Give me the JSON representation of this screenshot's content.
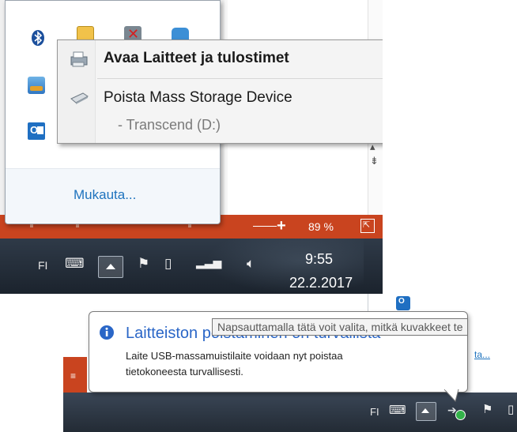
{
  "tray_overflow": {
    "customize_link": "Mukauta...",
    "icons": [
      "bluetooth-icon",
      "usb-drive-icon",
      "red-x-icon",
      "app-icon",
      "network-app-icon",
      "outlook-icon"
    ]
  },
  "context_menu": {
    "items": [
      {
        "label": "Avaa Laitteet ja tulostimet",
        "bold": true,
        "icon": "printer-icon"
      },
      {
        "label": "Poista Mass Storage Device",
        "bold": false,
        "icon": "usb-drive-icon"
      },
      {
        "label": "-  Transcend (D:)",
        "bold": false,
        "icon": ""
      }
    ]
  },
  "word_statusbar": {
    "zoom_plus": "+",
    "zoom_level": "89 %"
  },
  "taskbar_top": {
    "language": "FI",
    "time": "9:55",
    "date": "22.2.2017"
  },
  "balloon": {
    "title": "Laitteiston poistaminen on turvallista",
    "message_line1": "Laite USB-massamuistilaite voidaan nyt poistaa",
    "message_line2": "tietokoneesta turvallisesti."
  },
  "tooltip": {
    "text": "Napsauttamalla tätä voit valita, mitkä kuvakkeet te"
  },
  "behind_link": {
    "text": "ta..."
  },
  "taskbar_bottom": {
    "language": "FI"
  },
  "colors": {
    "office_accent": "#c9441f",
    "link_blue": "#1e73be",
    "info_blue": "#2a66c7",
    "taskbar_dark": "#1b232d"
  }
}
